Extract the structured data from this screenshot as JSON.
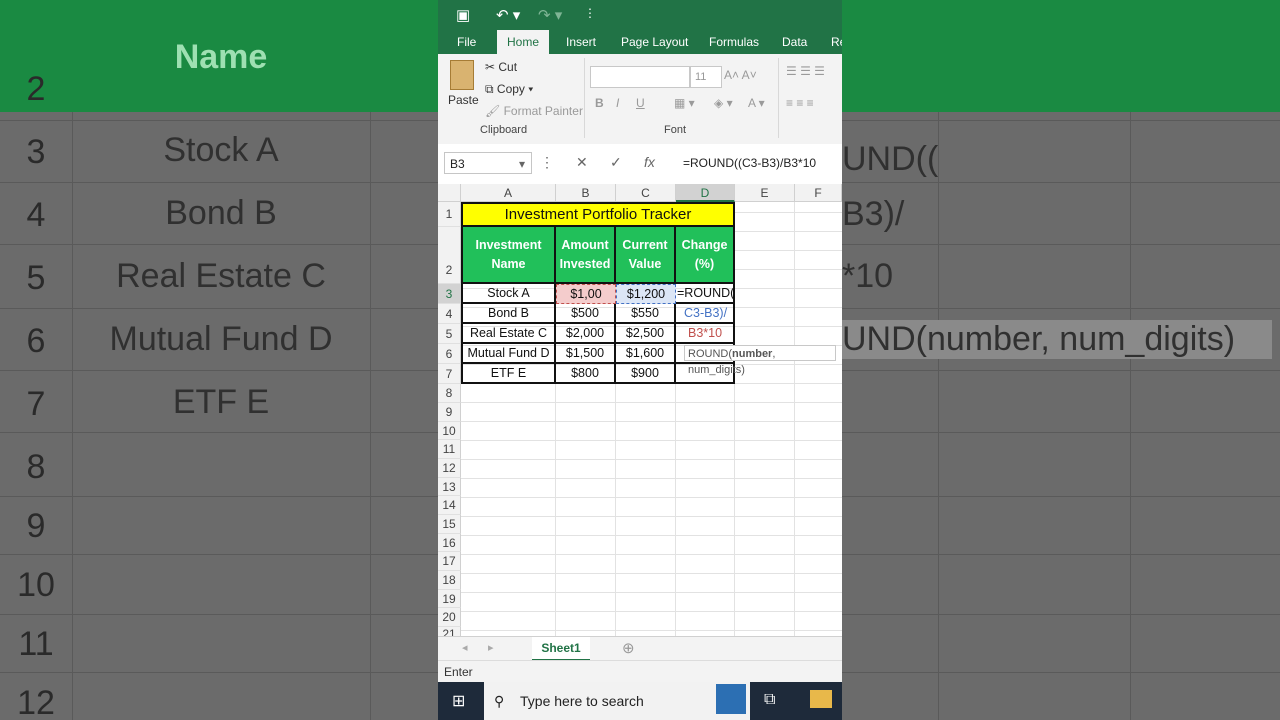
{
  "app": {
    "quick_access": {
      "save_icon": "save-icon",
      "undo_icon": "undo-icon",
      "redo_icon": "redo-icon"
    },
    "tabs": [
      "File",
      "Home",
      "Insert",
      "Page Layout",
      "Formulas",
      "Data",
      "Re"
    ],
    "active_tab": "Home",
    "ribbon": {
      "paste": "Paste",
      "cut": "Cut",
      "copy": "Copy",
      "format_painter": "Format Painter",
      "clipboard_group": "Clipboard",
      "font_group": "Font",
      "font_size": "11",
      "bold": "B",
      "italic": "I",
      "underline": "U"
    },
    "formula_bar": {
      "name_box": "B3",
      "formula": "=ROUND((C3-B3)/B3*10",
      "fx": "fx"
    },
    "columns": [
      "A",
      "B",
      "C",
      "D",
      "E",
      "F"
    ],
    "rows": [
      "1",
      "2",
      "3",
      "4",
      "5",
      "6",
      "7",
      "8",
      "9",
      "10",
      "11",
      "12",
      "13",
      "14",
      "15",
      "16",
      "17",
      "18",
      "19",
      "20",
      "21"
    ],
    "sheet": {
      "title": "Investment Portfolio Tracker",
      "headers": [
        "Investment Name",
        "Amount Invested",
        "Current Value",
        "Change (%)"
      ],
      "data": [
        [
          "Stock A",
          "$1,00",
          "$1,200",
          "=ROUND(("
        ],
        [
          "Bond B",
          "$500",
          "$550",
          "C3-B3)/"
        ],
        [
          "Real Estate C",
          "$2,000",
          "$2,500",
          "B3*10"
        ],
        [
          "Mutual Fund D",
          "$1,500",
          "$1,600",
          ""
        ],
        [
          "ETF E",
          "$800",
          "$900",
          ""
        ]
      ]
    },
    "tooltip": {
      "func": "ROUND(",
      "arg1": "number",
      "rest": ", num_digits)"
    },
    "sheet_tab": "Sheet1",
    "status": "Enter",
    "taskbar": {
      "search_placeholder": "Type here to search"
    }
  },
  "background": {
    "rows": [
      "2",
      "3",
      "4",
      "5",
      "6",
      "7",
      "8",
      "9",
      "10",
      "11",
      "12"
    ],
    "names": [
      "Name",
      "Stock A",
      "Bond B",
      "Real Estate C",
      "Mutual Fund D",
      "ETF E"
    ],
    "right_fragments": [
      "UND((",
      "B3)/",
      "*10",
      "UND(number, num_digits)"
    ]
  },
  "colors": {
    "excel_green": "#217346",
    "header_green": "#21c05a",
    "title_yellow": "#ffff00"
  }
}
